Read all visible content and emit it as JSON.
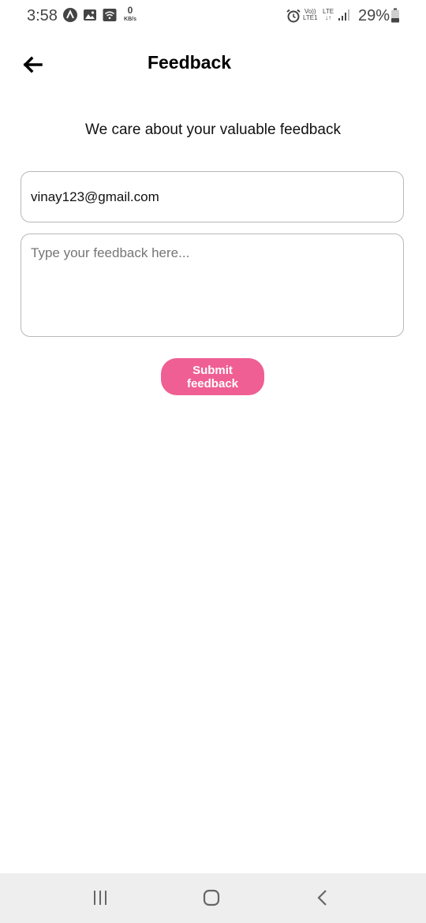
{
  "status_bar": {
    "time": "3:58",
    "data_rate_value": "0",
    "data_rate_unit": "KB/s",
    "volte_top": "Vo))",
    "volte_bottom": "LTE1",
    "lte_top": "LTE",
    "lte_bottom": "↓↑",
    "battery_percent": "29%",
    "icons": [
      "app-notification-icon",
      "gallery-icon",
      "wifi-icon",
      "alarm-icon",
      "signal-icon",
      "battery-icon"
    ]
  },
  "header": {
    "title": "Feedback",
    "back_icon": "arrow-left-icon"
  },
  "main": {
    "subtitle": "We care about your valuable feedback",
    "email_value": "vinay123@gmail.com",
    "feedback_placeholder": "Type your feedback here...",
    "submit_label": "Submit feedback"
  },
  "nav_bar": {
    "icons": [
      "recent-apps-icon",
      "home-icon",
      "back-icon"
    ]
  },
  "colors": {
    "accent": "#ef5f93",
    "nav_bg": "#eeeeee",
    "border": "#b8b8b8"
  }
}
